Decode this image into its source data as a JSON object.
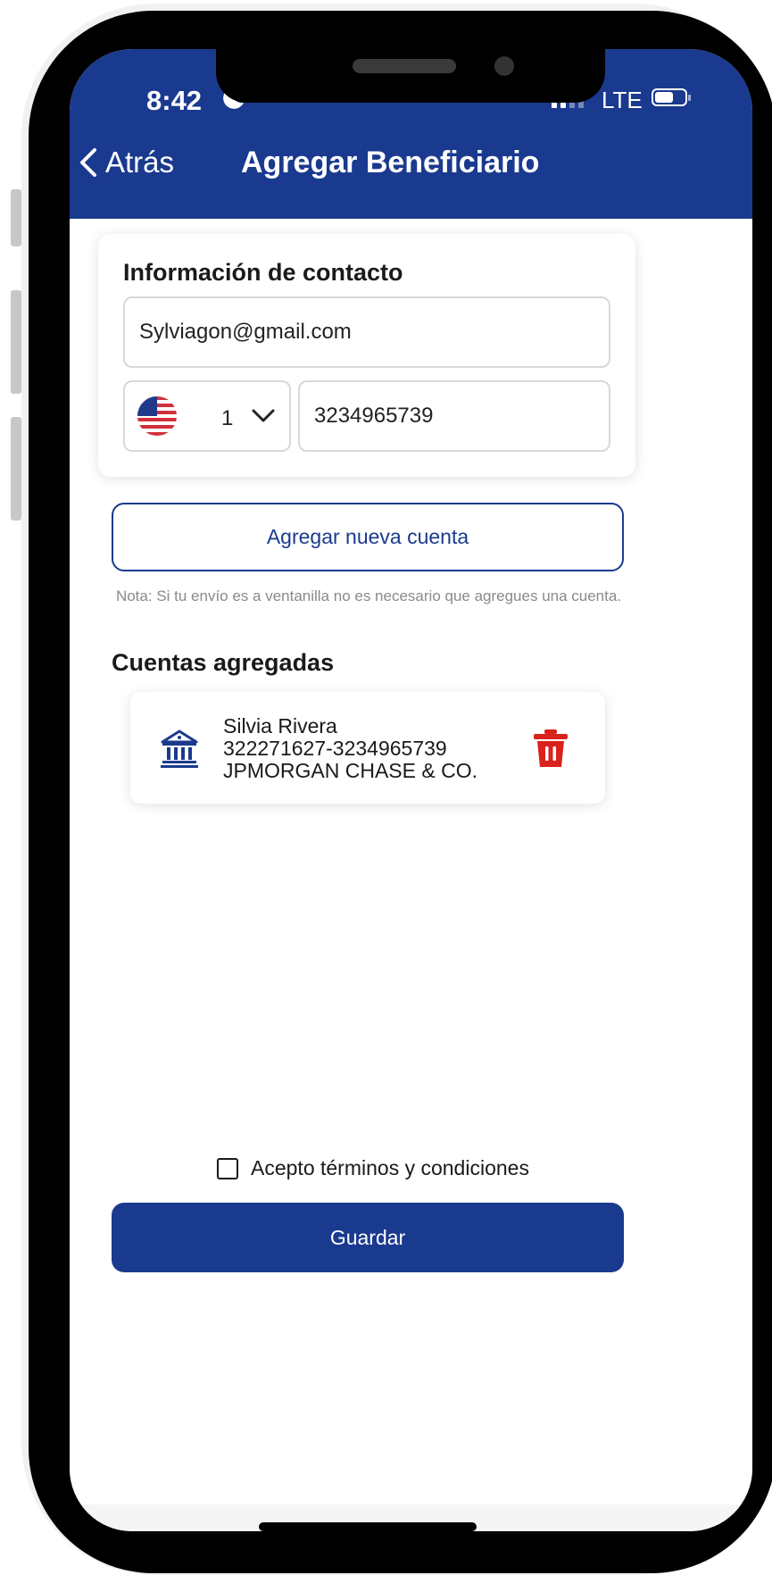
{
  "status_bar": {
    "time": "8:42",
    "network": "LTE"
  },
  "header": {
    "back_label": "Atrás",
    "title": "Agregar Beneficiario"
  },
  "contact_card": {
    "title": "Información de contacto",
    "email_value": "Sylviagon@gmail.com",
    "country_code": "1",
    "phone_value": "3234965739"
  },
  "add_account_button": "Agregar nueva cuenta",
  "note": "Nota: Si tu envío es a ventanilla no es necesario que agregues una cuenta.",
  "accounts_section": {
    "title": "Cuentas agregadas",
    "accounts": [
      {
        "name": "Silvia Rivera",
        "number": "322271627-3234965739",
        "bank": "JPMORGAN CHASE & CO."
      }
    ]
  },
  "terms_label": "Acepto términos y condiciones",
  "terms_checked": false,
  "save_button": "Guardar",
  "colors": {
    "primary": "#1a3a8f",
    "delete": "#d9221c"
  },
  "icons": [
    "chevron-left-icon",
    "us-flag-icon",
    "chevron-down-icon",
    "bank-icon",
    "trash-icon",
    "checkbox-icon"
  ]
}
